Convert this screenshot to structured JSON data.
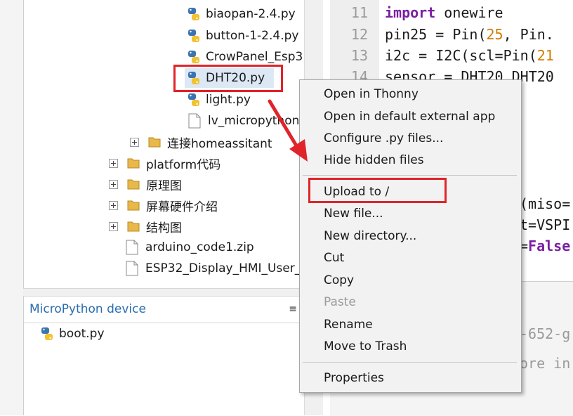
{
  "file_tree": {
    "items": [
      {
        "label": "biaopan-2.4.py",
        "kind": "python-file"
      },
      {
        "label": "button-1-2.4.py",
        "kind": "python-file"
      },
      {
        "label": "CrowPanel_Esp3",
        "kind": "python-file"
      },
      {
        "label": "DHT20.py",
        "kind": "python-file",
        "selected": true
      },
      {
        "label": "light.py",
        "kind": "python-file"
      },
      {
        "label": "lv_micropython",
        "kind": "file"
      },
      {
        "label": "连接homeassitant",
        "kind": "folder"
      },
      {
        "label": "platform代码",
        "kind": "folder"
      },
      {
        "label": "原理图",
        "kind": "folder"
      },
      {
        "label": "屏幕硬件介绍",
        "kind": "folder"
      },
      {
        "label": "结构图",
        "kind": "folder"
      },
      {
        "label": "arduino_code1.zip",
        "kind": "file"
      },
      {
        "label": "ESP32_Display_HMI_User_",
        "kind": "file"
      }
    ]
  },
  "device_panel": {
    "title": "MicroPython device",
    "menu_glyph": "≡",
    "files": [
      {
        "label": "boot.py",
        "kind": "python-file"
      }
    ]
  },
  "editor": {
    "lines": [
      {
        "number": "11",
        "segments": [
          {
            "t": "import",
            "c": "kw"
          },
          {
            "t": " onewire",
            "c": ""
          }
        ]
      },
      {
        "number": "12",
        "segments": [
          {
            "t": "pin25 = Pin(",
            "c": ""
          },
          {
            "t": "25",
            "c": "num"
          },
          {
            "t": ", Pin.",
            "c": ""
          }
        ]
      },
      {
        "number": "13",
        "segments": [
          {
            "t": "i2c = I2C(scl=Pin(",
            "c": ""
          },
          {
            "t": "21",
            "c": "num"
          }
        ]
      },
      {
        "number": "14",
        "segments": [
          {
            "t": "sensor = DHT20.DHT20",
            "c": ""
          }
        ]
      }
    ],
    "hidden_fragments": [
      {
        "segments": [
          {
            "t": "(miso=",
            "c": ""
          }
        ]
      },
      {
        "segments": [
          {
            "t": "t=VSPI",
            "c": ""
          }
        ]
      },
      {
        "segments": [
          {
            "t": "=",
            "c": ""
          },
          {
            "t": "False",
            "c": "kw"
          }
        ]
      }
    ]
  },
  "shell": {
    "fragments": [
      "-652-g",
      "ore in"
    ]
  },
  "context_menu": {
    "items": [
      {
        "label": "Open in Thonny",
        "enabled": true
      },
      {
        "label": "Open in default external app",
        "enabled": true
      },
      {
        "label": "Configure .py files...",
        "enabled": true
      },
      {
        "label": "Hide hidden files",
        "enabled": true
      },
      {
        "separator": true
      },
      {
        "label": "Upload to /",
        "enabled": true,
        "highlighted": true
      },
      {
        "label": "New file...",
        "enabled": true
      },
      {
        "label": "New directory...",
        "enabled": true
      },
      {
        "label": "Cut",
        "enabled": true
      },
      {
        "label": "Copy",
        "enabled": true
      },
      {
        "label": "Paste",
        "enabled": false
      },
      {
        "label": "Rename",
        "enabled": true
      },
      {
        "label": "Move to Trash",
        "enabled": true
      },
      {
        "separator": true
      },
      {
        "label": "Properties",
        "enabled": true
      }
    ]
  },
  "colors": {
    "annotation_red": "#e0242a",
    "device_title_blue": "#2a6cb0",
    "keyword_purple": "#7a1fa2",
    "number_orange": "#d07a00"
  }
}
